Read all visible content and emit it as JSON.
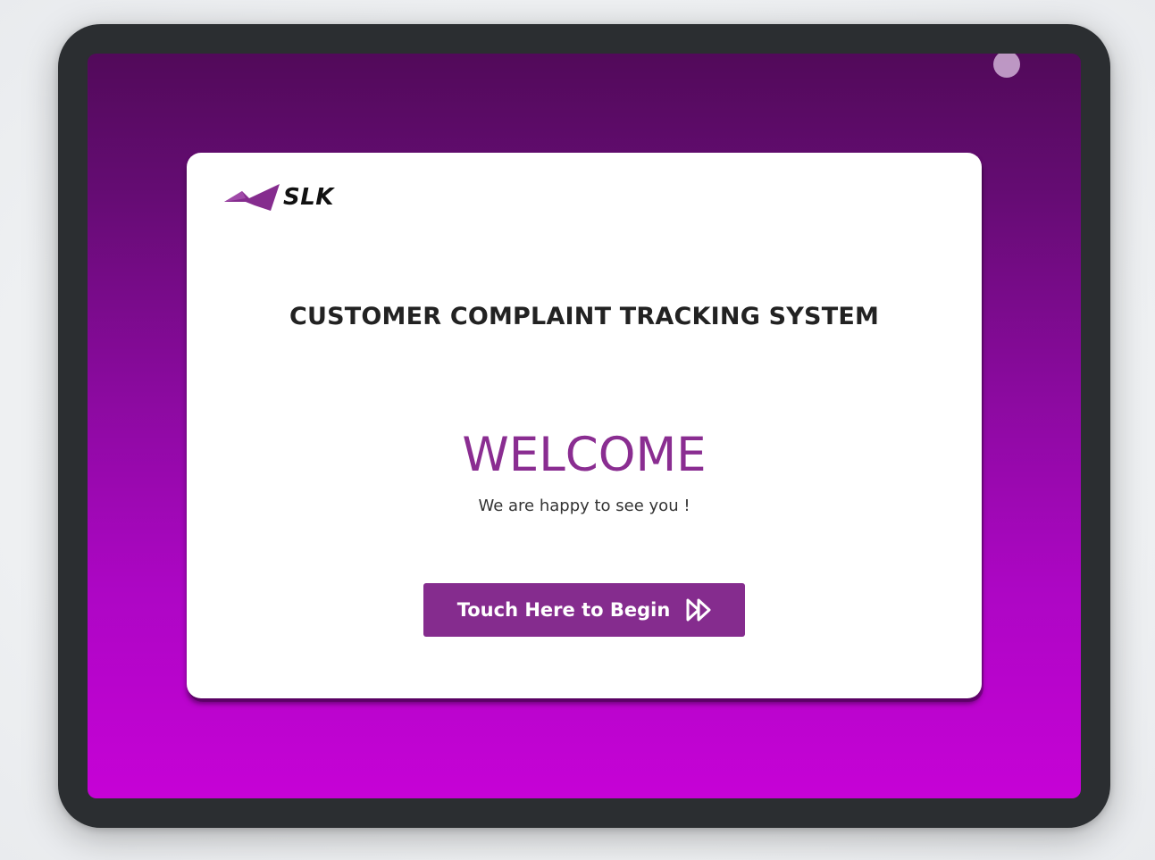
{
  "brand": {
    "name": "SLK",
    "logo_icon": "slk-logo-icon",
    "accent_color": "#852c8e"
  },
  "card": {
    "system_title": "CUSTOMER COMPLAINT TRACKING SYSTEM",
    "welcome": "WELCOME",
    "subtitle": "We are happy to see you !",
    "begin_button": {
      "label": "Touch Here to Begin",
      "icon": "fast-forward-icon"
    }
  },
  "colors": {
    "frame": "#2b2e31",
    "gradient_top": "#520a5a",
    "gradient_bottom": "#c602d6",
    "welcome_text": "#8a2d91"
  }
}
